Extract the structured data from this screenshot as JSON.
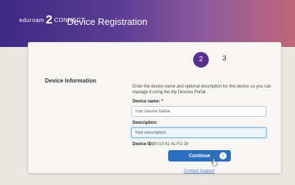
{
  "header": {
    "logo_text_left": "eduroam",
    "logo_big": "2",
    "logo_text_right": "CONNECT",
    "title": "Device Registration"
  },
  "steps": {
    "active": "2",
    "next": "3"
  },
  "section": {
    "title": "Device Information",
    "intro": "Enter the device name and optional description for this device so you can manage it using the My Devices Portal."
  },
  "form": {
    "device_name_label": "Device name: *",
    "device_name_value": "Your Device Name",
    "description_label": "Description:",
    "description_value": "Your Description",
    "device_id_label": "Device ID:",
    "device_id_value": "B0:10:41:41:FD:28"
  },
  "actions": {
    "continue_label": "Continue",
    "continue_icon": "arrow-right-icon",
    "support_link": "Contact Support"
  },
  "colors": {
    "brand": "#5a2f8f",
    "button": "#2b6ec2"
  }
}
